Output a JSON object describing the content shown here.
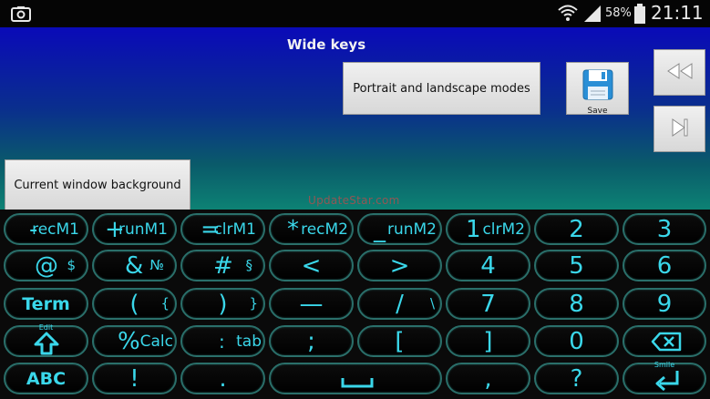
{
  "status_bar": {
    "battery_percent": "58%",
    "time": "21:11",
    "icons": [
      "screenshot-icon",
      "wifi-icon",
      "signal-icon",
      "battery-icon"
    ]
  },
  "app": {
    "title": "Wide keys",
    "portrait_button": "Portrait and landscape modes",
    "background_button": "Current window background",
    "save_label": "Save",
    "watermark": "UpdateStar.com"
  },
  "colors": {
    "key_text": "#3ad7ea",
    "key_border": "#2a6f6a",
    "gradient_top": "#0a0ab8",
    "gradient_bottom": "#0d8274"
  },
  "keyboard": {
    "row1": [
      {
        "main": "-",
        "sub": "recM1"
      },
      {
        "main": "+",
        "sub": "runM1"
      },
      {
        "main": "=",
        "sub": "clrM1"
      },
      {
        "main": "*",
        "sub": "recM2"
      },
      {
        "main": "_",
        "sub": "runM2"
      },
      {
        "main": "1",
        "sub": "clrM2"
      },
      {
        "main": "2"
      },
      {
        "main": "3"
      }
    ],
    "row2": [
      {
        "main": "@",
        "sub": "$"
      },
      {
        "main": "&",
        "sub": "№"
      },
      {
        "main": "#",
        "sub": "§"
      },
      {
        "main": "<"
      },
      {
        "main": ">"
      },
      {
        "main": "4"
      },
      {
        "main": "5"
      },
      {
        "main": "6"
      }
    ],
    "row3": [
      {
        "main": "Term"
      },
      {
        "main": "(",
        "sub": "{"
      },
      {
        "main": ")",
        "sub": "}"
      },
      {
        "main": "—"
      },
      {
        "main": "/",
        "sub": "\\"
      },
      {
        "main": "7"
      },
      {
        "main": "8"
      },
      {
        "main": "9"
      }
    ],
    "row4": [
      {
        "tiny": "Edit"
      },
      {
        "main": "%",
        "sub": "Calc"
      },
      {
        "main": ":",
        "sub": "tab"
      },
      {
        "main": ";"
      },
      {
        "main": "["
      },
      {
        "main": "]"
      },
      {
        "main": "0"
      }
    ],
    "row5": [
      {
        "main": "ABC"
      },
      {
        "main": "!"
      },
      {
        "main": "."
      },
      {
        "main": ","
      },
      {
        "main": "?"
      },
      {
        "tiny": "Smile"
      }
    ]
  }
}
